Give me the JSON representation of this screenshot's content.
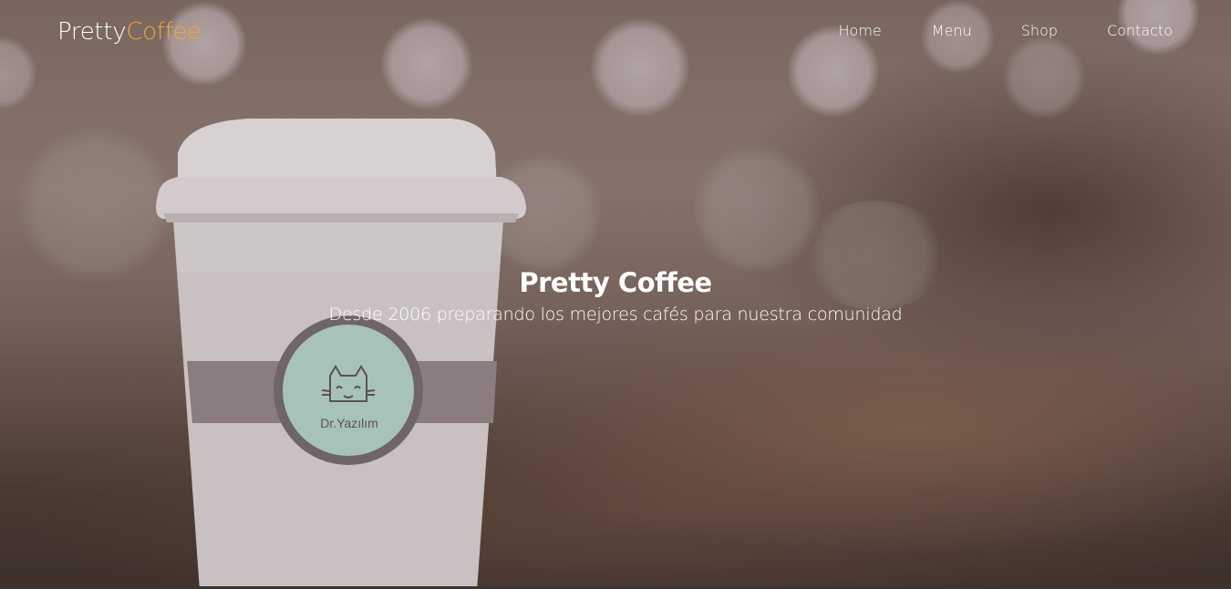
{
  "brand": {
    "part1": "Pretty",
    "part2": "Coffee",
    "accent_color": "#f5a52b"
  },
  "nav": {
    "items": [
      {
        "label": "Home"
      },
      {
        "label": "Menu"
      },
      {
        "label": "Shop"
      },
      {
        "label": "Contacto"
      }
    ]
  },
  "hero": {
    "title": "Pretty Coffee",
    "subtitle": "Desde 2006 preparando los mejores cafés para nuestra comunidad",
    "cup_logo_text": "Dr.Yazılım",
    "cup_logo_icon": "cat-face-icon"
  }
}
